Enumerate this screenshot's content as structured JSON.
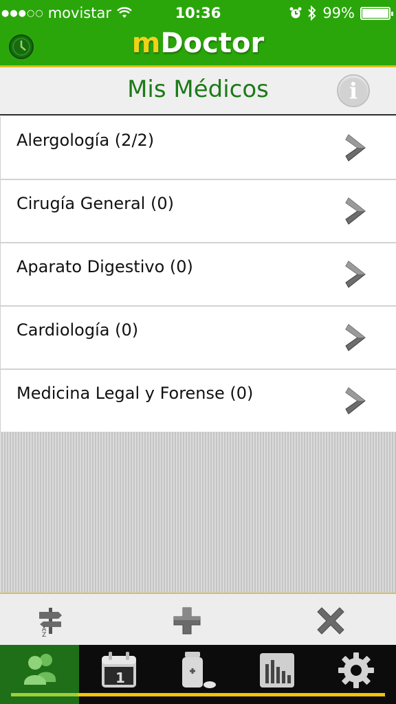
{
  "status_bar": {
    "carrier": "movistar",
    "time": "10:36",
    "battery": "99%"
  },
  "app": {
    "title_prefix": "m",
    "title_rest": "Doctor"
  },
  "header": {
    "title": "Mis Médicos"
  },
  "specialties": [
    {
      "label": "Alergología (2/2)"
    },
    {
      "label": "Cirugía General (0)"
    },
    {
      "label": "Aparato Digestivo (0)"
    },
    {
      "label": "Cardiología (0)"
    },
    {
      "label": "Medicina Legal y Forense (0)"
    }
  ],
  "toolbar": {
    "icons": [
      "sort-az-signpost-icon",
      "plus-icon",
      "close-icon"
    ]
  },
  "tabbar": {
    "icons": [
      "doctors-icon",
      "calendar-icon",
      "medication-icon",
      "stats-icon",
      "settings-icon"
    ],
    "active_index": 0,
    "calendar_day": "1"
  },
  "colors": {
    "brand_green": "#2aa60a",
    "title_yellow": "#f0d21a",
    "header_title_green": "#1c7a17",
    "active_tab": "#1f6f18",
    "tab_underline": "#f2c400"
  }
}
